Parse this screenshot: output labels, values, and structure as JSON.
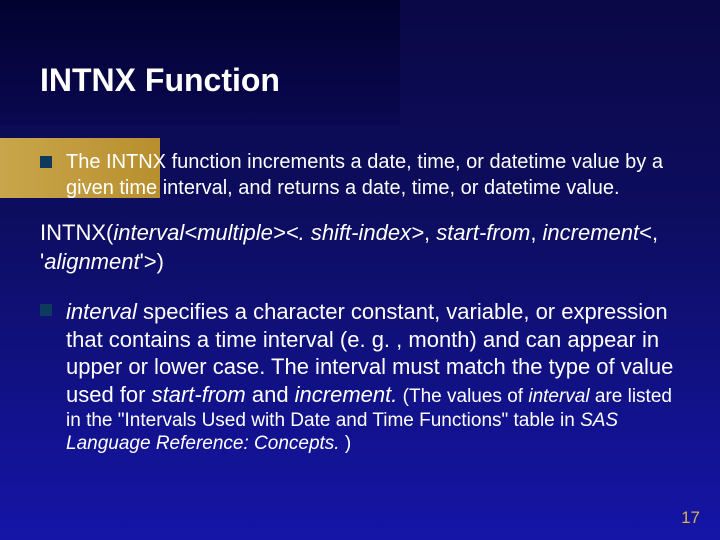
{
  "title": "INTNX Function",
  "bullets": {
    "first": "The INTNX function increments a date, time, or datetime value by a given time interval, and returns a date, time, or datetime value."
  },
  "syntax": {
    "p1": "INTNX(",
    "p2": "interval<multiple><. shift-index>",
    "p3": ", ",
    "p4": "start-from",
    "p5": ", ",
    "p6": "increment",
    "p7": "<, '",
    "p8": "alignment",
    "p9": "'>)"
  },
  "detail": {
    "d1": "interval",
    "d2": " specifies a character constant, variable, or expression that contains a time interval (e. g. , month) and can appear in upper or lower case. The interval must match the type of value used for ",
    "d3": "start-from",
    "d4": " and ",
    "d5": "increment.",
    "t1": " (The values of ",
    "t2": "interval",
    "t3": " are listed in the \"Intervals Used with Date and Time Functions\" table in ",
    "t4": "SAS Language Reference: Concepts.",
    "t5": " )"
  },
  "page": "17"
}
